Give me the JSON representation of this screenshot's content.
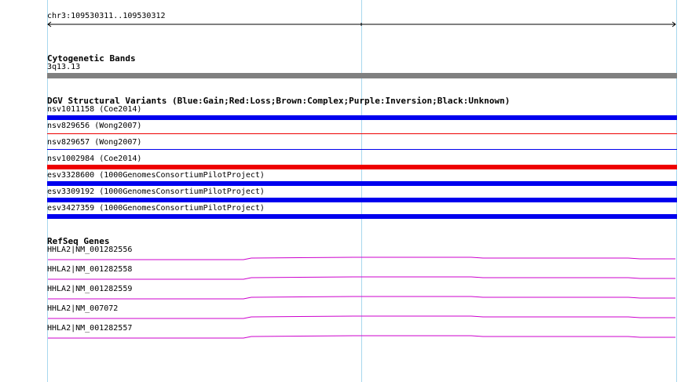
{
  "ruler": {
    "label": "chr3:109530311..109530312"
  },
  "cytoband": {
    "title": "Cytogenetic Bands",
    "band": "3q13.13",
    "color": "#808080"
  },
  "dgv": {
    "title": "DGV Structural Variants (Blue:Gain;Red:Loss;Brown:Complex;Purple:Inversion;Black:Unknown)",
    "items": [
      {
        "label": "nsv1011158 (Coe2014)",
        "color": "#0000ee",
        "style": "thick"
      },
      {
        "label": "nsv829656 (Wong2007)",
        "color": "#ee0000",
        "style": "thin"
      },
      {
        "label": "nsv829657 (Wong2007)",
        "color": "#0000ee",
        "style": "thin"
      },
      {
        "label": "nsv1002984 (Coe2014)",
        "color": "#ee0000",
        "style": "thick"
      },
      {
        "label": "esv3328600 (1000GenomesConsortiumPilotProject)",
        "color": "#0000ee",
        "style": "thick"
      },
      {
        "label": "esv3309192 (1000GenomesConsortiumPilotProject)",
        "color": "#0000ee",
        "style": "thick"
      },
      {
        "label": "esv3427359 (1000GenomesConsortiumPilotProject)",
        "color": "#0000ee",
        "style": "thick"
      }
    ]
  },
  "refseq": {
    "title": "RefSeq Genes",
    "color": "#cc00cc",
    "items": [
      {
        "label": "HHLA2|NM_001282556"
      },
      {
        "label": "HHLA2|NM_001282558"
      },
      {
        "label": "HHLA2|NM_001282559"
      },
      {
        "label": "HHLA2|NM_007072"
      },
      {
        "label": "HHLA2|NM_001282557"
      }
    ]
  }
}
